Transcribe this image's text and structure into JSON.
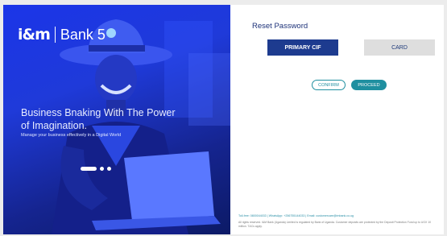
{
  "brand": {
    "logo_mark": "i&m",
    "logo_text": "Bank 5"
  },
  "hero": {
    "title": "Business Bnaking With The Power of Imagination.",
    "subtitle": "Manage your business effectively in a Digital World"
  },
  "form": {
    "title": "Reset Password",
    "tabs": [
      {
        "label": "PRIMARY CIF",
        "active": true
      },
      {
        "label": "CARD",
        "active": false
      }
    ],
    "confirm_label": "CONFIRM",
    "proceed_label": "PROCEED"
  },
  "footer": {
    "contact": "Toll-free: 0800044033 | WhatsApp: +256755144033 | Email: customercare@imbank.co.ug",
    "legal": "All rights reserved. I&M Bank (Uganda) Limited is regulated by Bank of Uganda. Customer deposits are protected by the Deposit Protection Fund up to UGX 10 million. T&Cs apply."
  },
  "colors": {
    "primary": "#1d3b8f",
    "accent": "#1f8fa0",
    "hero_blue": "#1b35e8"
  }
}
